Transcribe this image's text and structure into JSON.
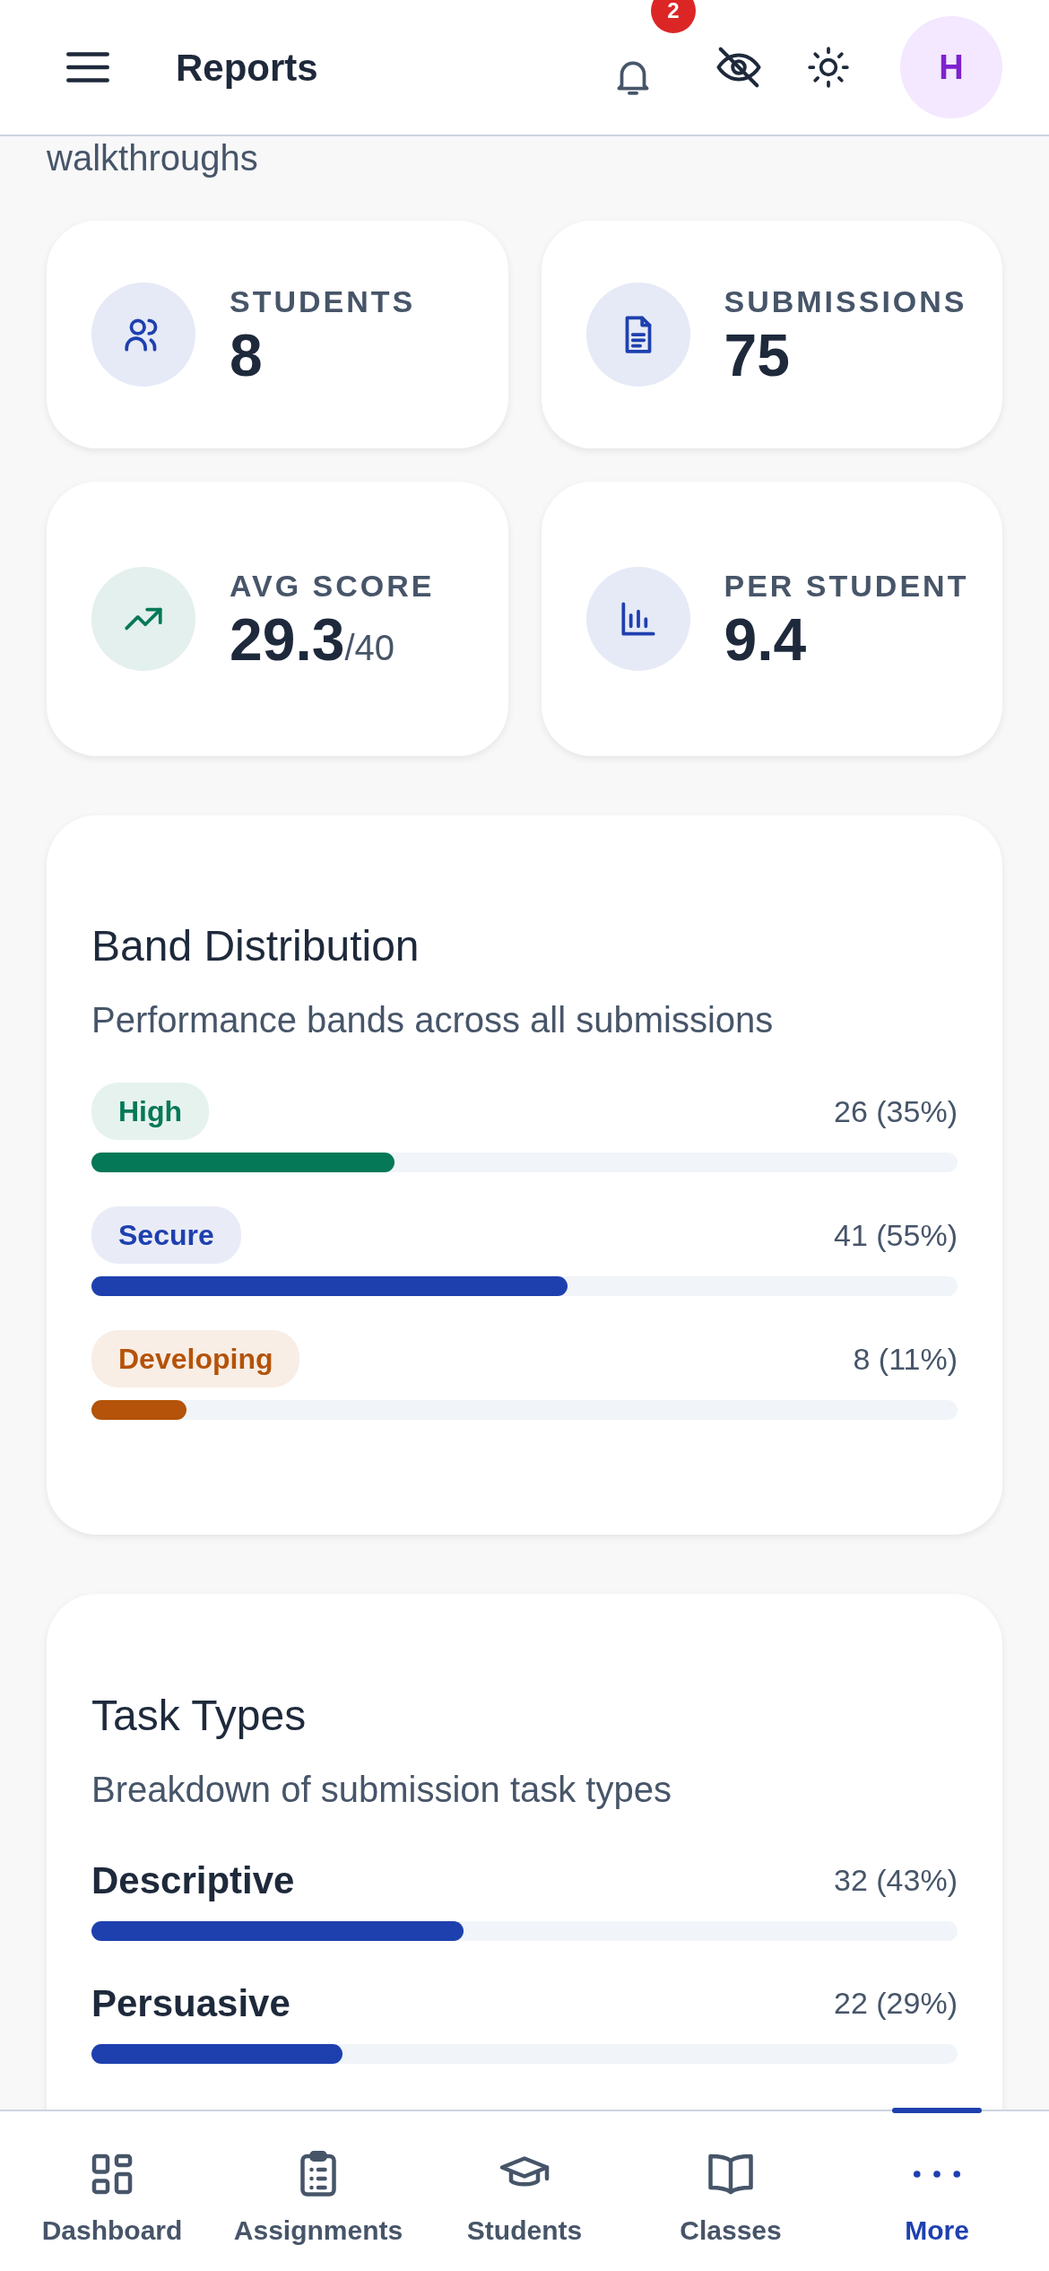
{
  "header": {
    "title": "Reports",
    "notifications": "2",
    "avatar": "H"
  },
  "behind_text": "walkthroughs",
  "stats": [
    {
      "label": "STUDENTS",
      "value": "8",
      "color": "#1e40af"
    },
    {
      "label": "SUBMISSIONS",
      "value": "75",
      "color": "#1e40af"
    },
    {
      "label": "AVG SCORE",
      "value": "29.3",
      "suffix": "/40",
      "color": "#047857"
    },
    {
      "label": "PER STUDENT",
      "value": "9.4",
      "color": "#1e40af"
    }
  ],
  "band_distribution": {
    "title": "Band Distribution",
    "subtitle": "Performance bands across all submissions",
    "bands": [
      {
        "label": "High",
        "count": "26 (35%)",
        "level": 0.35,
        "color": "#047857"
      },
      {
        "label": "Secure",
        "count": "41 (55%)",
        "level": 0.55,
        "color": "#1e40af"
      },
      {
        "label": "Developing",
        "count": "8 (11%)",
        "level": 0.11,
        "color": "#b45309"
      }
    ]
  },
  "task_types": {
    "title": "Task Types",
    "subtitle": "Breakdown of submission task types",
    "types": [
      {
        "label": "Descriptive",
        "count": "32 (43%)",
        "level": 0.43
      },
      {
        "label": "Persuasive",
        "count": "22 (29%)",
        "level": 0.29
      }
    ]
  },
  "bottom_nav": [
    {
      "label": "Dashboard",
      "selected": false
    },
    {
      "label": "Assignments",
      "selected": false
    },
    {
      "label": "Students",
      "selected": false
    },
    {
      "label": "Classes",
      "selected": false
    },
    {
      "label": "More",
      "selected": true
    }
  ]
}
